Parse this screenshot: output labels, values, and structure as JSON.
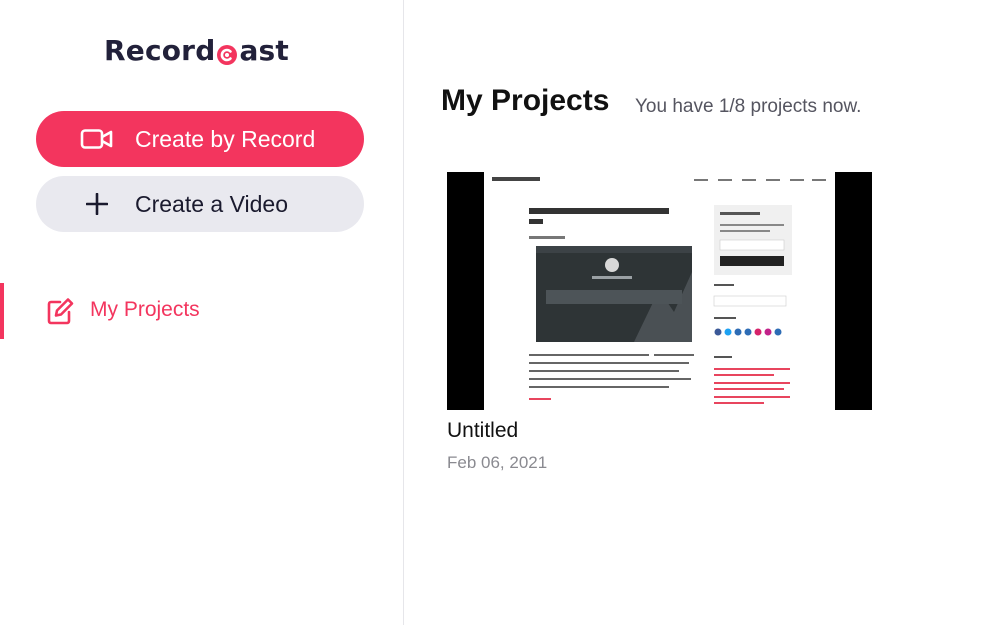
{
  "app": {
    "logo_text_start": "Record",
    "logo_text_end": "ast",
    "brand_color": "#f3355e"
  },
  "sidebar": {
    "create_record": {
      "label": "Create by Record",
      "icon": "video-camera-icon"
    },
    "create_video": {
      "label": "Create a Video",
      "icon": "plus-icon"
    },
    "nav": [
      {
        "label": "My Projects",
        "icon": "edit-square-icon",
        "active": true
      }
    ]
  },
  "main": {
    "title": "My Projects",
    "project_count_text": "You have 1/8 projects now.",
    "projects": [
      {
        "title": "Untitled",
        "date": "Feb 06, 2021"
      }
    ]
  }
}
